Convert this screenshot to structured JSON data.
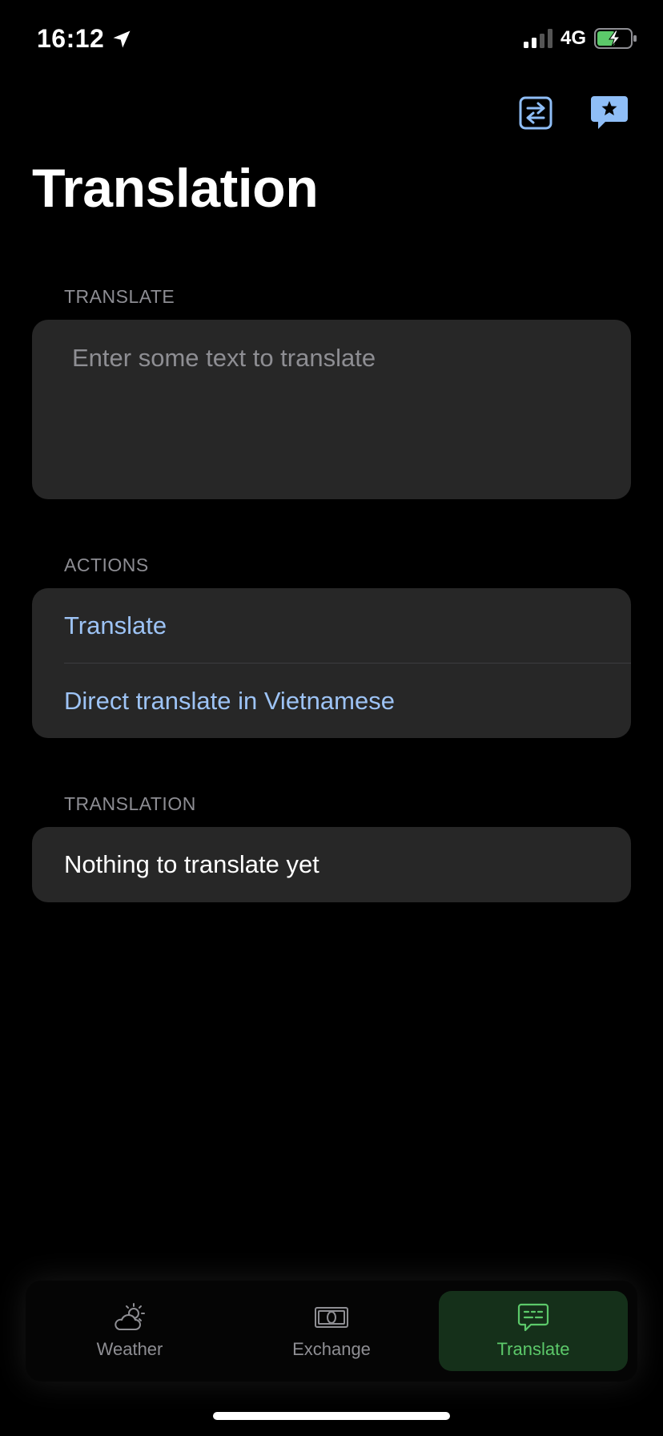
{
  "status_bar": {
    "time": "16:12",
    "network": "4G"
  },
  "header": {
    "title": "Translation",
    "icons": [
      "swap-languages-icon",
      "favorite-chat-icon"
    ]
  },
  "translate_section": {
    "header": "TRANSLATE",
    "placeholder": "Enter some text to translate",
    "value": ""
  },
  "actions_section": {
    "header": "ACTIONS",
    "items": [
      {
        "label": "Translate"
      },
      {
        "label": "Direct translate in Vietnamese"
      }
    ]
  },
  "translation_section": {
    "header": "TRANSLATION",
    "result": "Nothing to translate yet"
  },
  "tab_bar": {
    "tabs": [
      {
        "label": "Weather",
        "icon": "weather-icon",
        "active": false
      },
      {
        "label": "Exchange",
        "icon": "exchange-icon",
        "active": false
      },
      {
        "label": "Translate",
        "icon": "translate-icon",
        "active": true
      }
    ]
  },
  "colors": {
    "background": "#000000",
    "card": "#272727",
    "accent_blue": "#9dc3f5",
    "active_green": "#5cc96a",
    "secondary_text": "#8d8d93"
  }
}
